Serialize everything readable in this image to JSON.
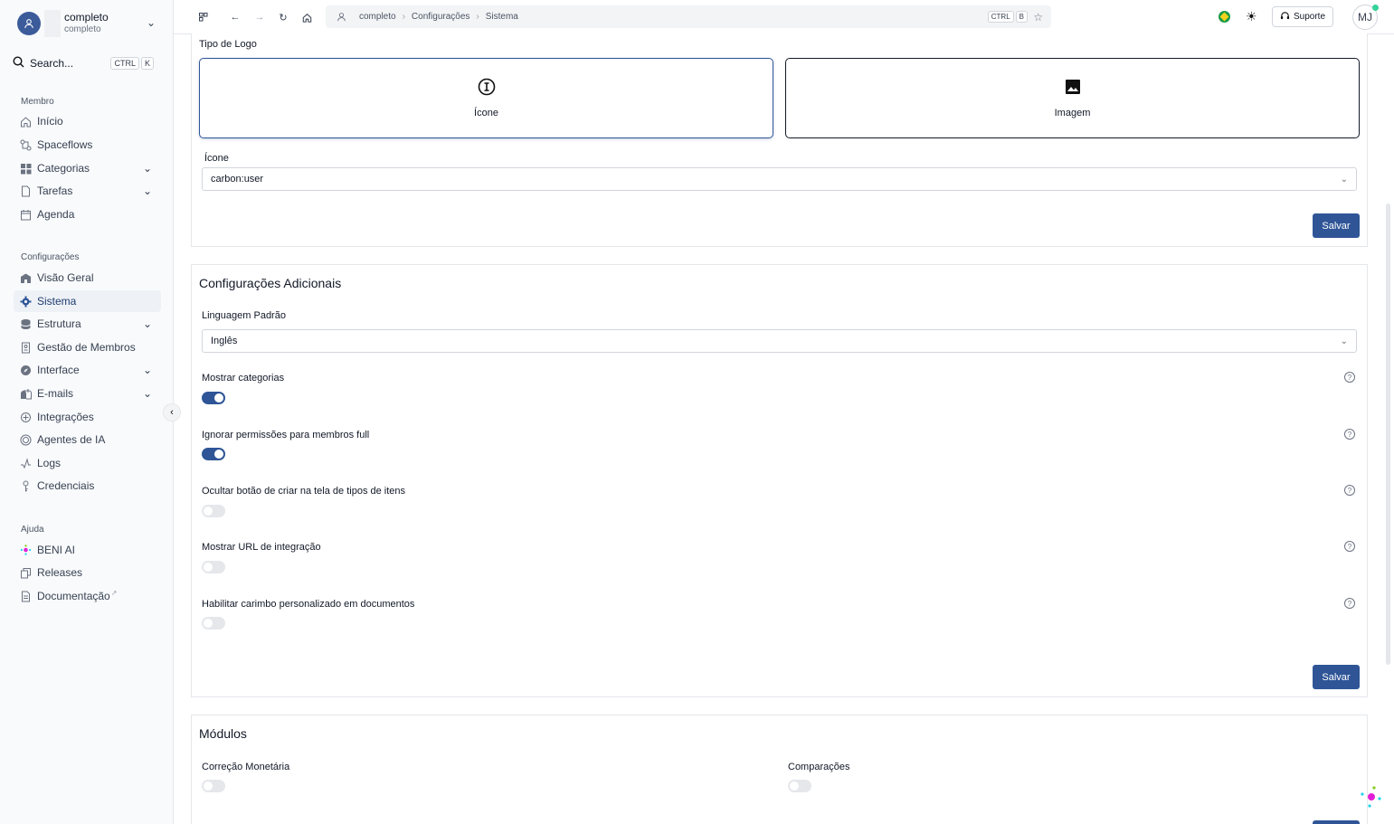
{
  "workspace": {
    "name": "completo",
    "subtitle": "completo"
  },
  "search": {
    "label": "Search...",
    "key1": "CTRL",
    "key2": "K"
  },
  "sidebar": {
    "section_member": "Membro",
    "section_config": "Configurações",
    "section_help": "Ajuda",
    "member_items": [
      {
        "label": "Início",
        "icon": "home-icon"
      },
      {
        "label": "Spaceflows",
        "icon": "flow-icon"
      },
      {
        "label": "Categorias",
        "icon": "grid-icon"
      },
      {
        "label": "Tarefas",
        "icon": "document-icon"
      },
      {
        "label": "Agenda",
        "icon": "calendar-icon"
      }
    ],
    "config_items": [
      {
        "label": "Visão Geral",
        "icon": "building-icon"
      },
      {
        "label": "Sistema",
        "icon": "gear-icon"
      },
      {
        "label": "Estrutura",
        "icon": "database-icon"
      },
      {
        "label": "Gestão de Membros",
        "icon": "id-badge-icon"
      },
      {
        "label": "Interface",
        "icon": "compass-icon"
      },
      {
        "label": "E-mails",
        "icon": "mailbox-icon"
      },
      {
        "label": "Integrações",
        "icon": "integration-icon"
      },
      {
        "label": "Agentes de IA",
        "icon": "ai-agent-icon"
      },
      {
        "label": "Logs",
        "icon": "activity-icon"
      },
      {
        "label": "Credenciais",
        "icon": "key-icon"
      }
    ],
    "help_items": [
      {
        "label": "BENI AI",
        "icon": "beni-icon"
      },
      {
        "label": "Releases",
        "icon": "releases-icon"
      },
      {
        "label": "Documentação",
        "icon": "document-icon"
      }
    ]
  },
  "topbar": {
    "breadcrumb": [
      "completo",
      "Configurações",
      "Sistema"
    ],
    "shortcut_key1": "CTRL",
    "shortcut_key2": "B",
    "support_label": "Suporte",
    "user_initials": "MJ"
  },
  "logo_section": {
    "title": "Tipo de Logo",
    "option_icon": "Ícone",
    "option_image": "Imagem",
    "icon_field_label": "Ícone",
    "icon_field_value": "carbon:user",
    "save_label": "Salvar"
  },
  "additional": {
    "title": "Configurações Adicionais",
    "language_label": "Linguagem Padrão",
    "language_value": "Inglês",
    "settings": [
      {
        "label": "Mostrar categorias",
        "enabled": true
      },
      {
        "label": "Ignorar permissões para membros full",
        "enabled": true
      },
      {
        "label": "Ocultar botão de criar na tela de tipos de itens",
        "enabled": false
      },
      {
        "label": "Mostrar URL de integração",
        "enabled": false
      },
      {
        "label": "Habilitar carimbo personalizado em documentos",
        "enabled": false
      }
    ],
    "save_label": "Salvar"
  },
  "modules": {
    "title": "Módulos",
    "items": [
      {
        "label": "Correção Monetária",
        "enabled": false
      },
      {
        "label": "Comparações",
        "enabled": false
      }
    ]
  },
  "colors": {
    "primary": "#2f5597",
    "accent_green": "#34d399"
  }
}
